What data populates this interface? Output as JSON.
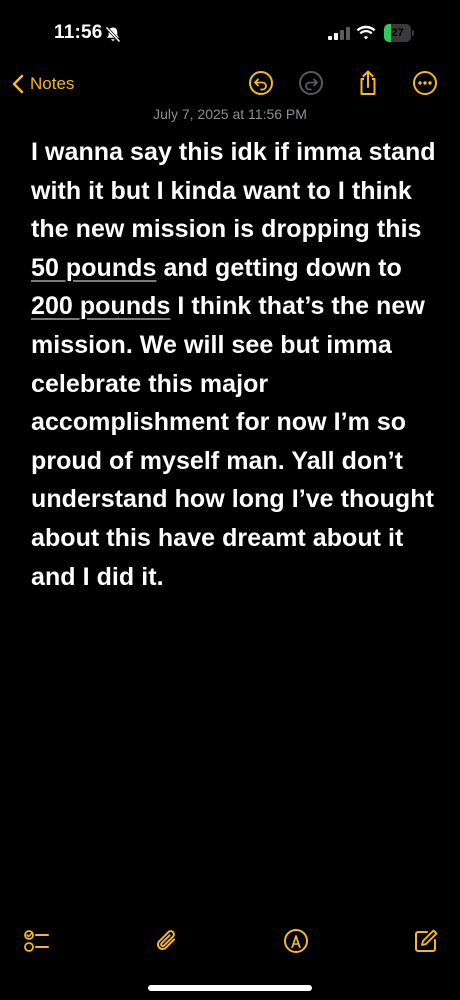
{
  "status_bar": {
    "time": "11:56",
    "battery_level": "27",
    "battery_fraction": 0.27,
    "icons": [
      "bell-slash-icon",
      "cellular-signal-icon",
      "wifi-icon",
      "battery-icon"
    ]
  },
  "nav": {
    "back_label": "Notes",
    "icons": [
      "chevron-left-icon",
      "undo-icon",
      "redo-icon",
      "share-icon",
      "more-icon"
    ]
  },
  "note": {
    "date": "July 7, 2025 at 11:56 PM",
    "text_1": "I wanna say this idk if imma stand with it but I kinda want to I think the new mission is dropping this ",
    "link_1": "50 pounds",
    "text_2": " and getting down to ",
    "link_2": "200 pounds",
    "text_3": " I think that’s the new mission. We will see but imma celebrate this major accomplishment for now I’m so proud of myself man. Yall don’t understand how long I’ve thought about this have dreamt about it and I did it."
  },
  "toolbar": {
    "icons": [
      "checklist-icon",
      "paperclip-icon",
      "markup-icon",
      "compose-icon"
    ]
  },
  "colors": {
    "accent": "#f5b628",
    "background": "#000000",
    "text": "#ffffff",
    "secondary_text": "#8e8e93",
    "battery": "#34c759"
  }
}
